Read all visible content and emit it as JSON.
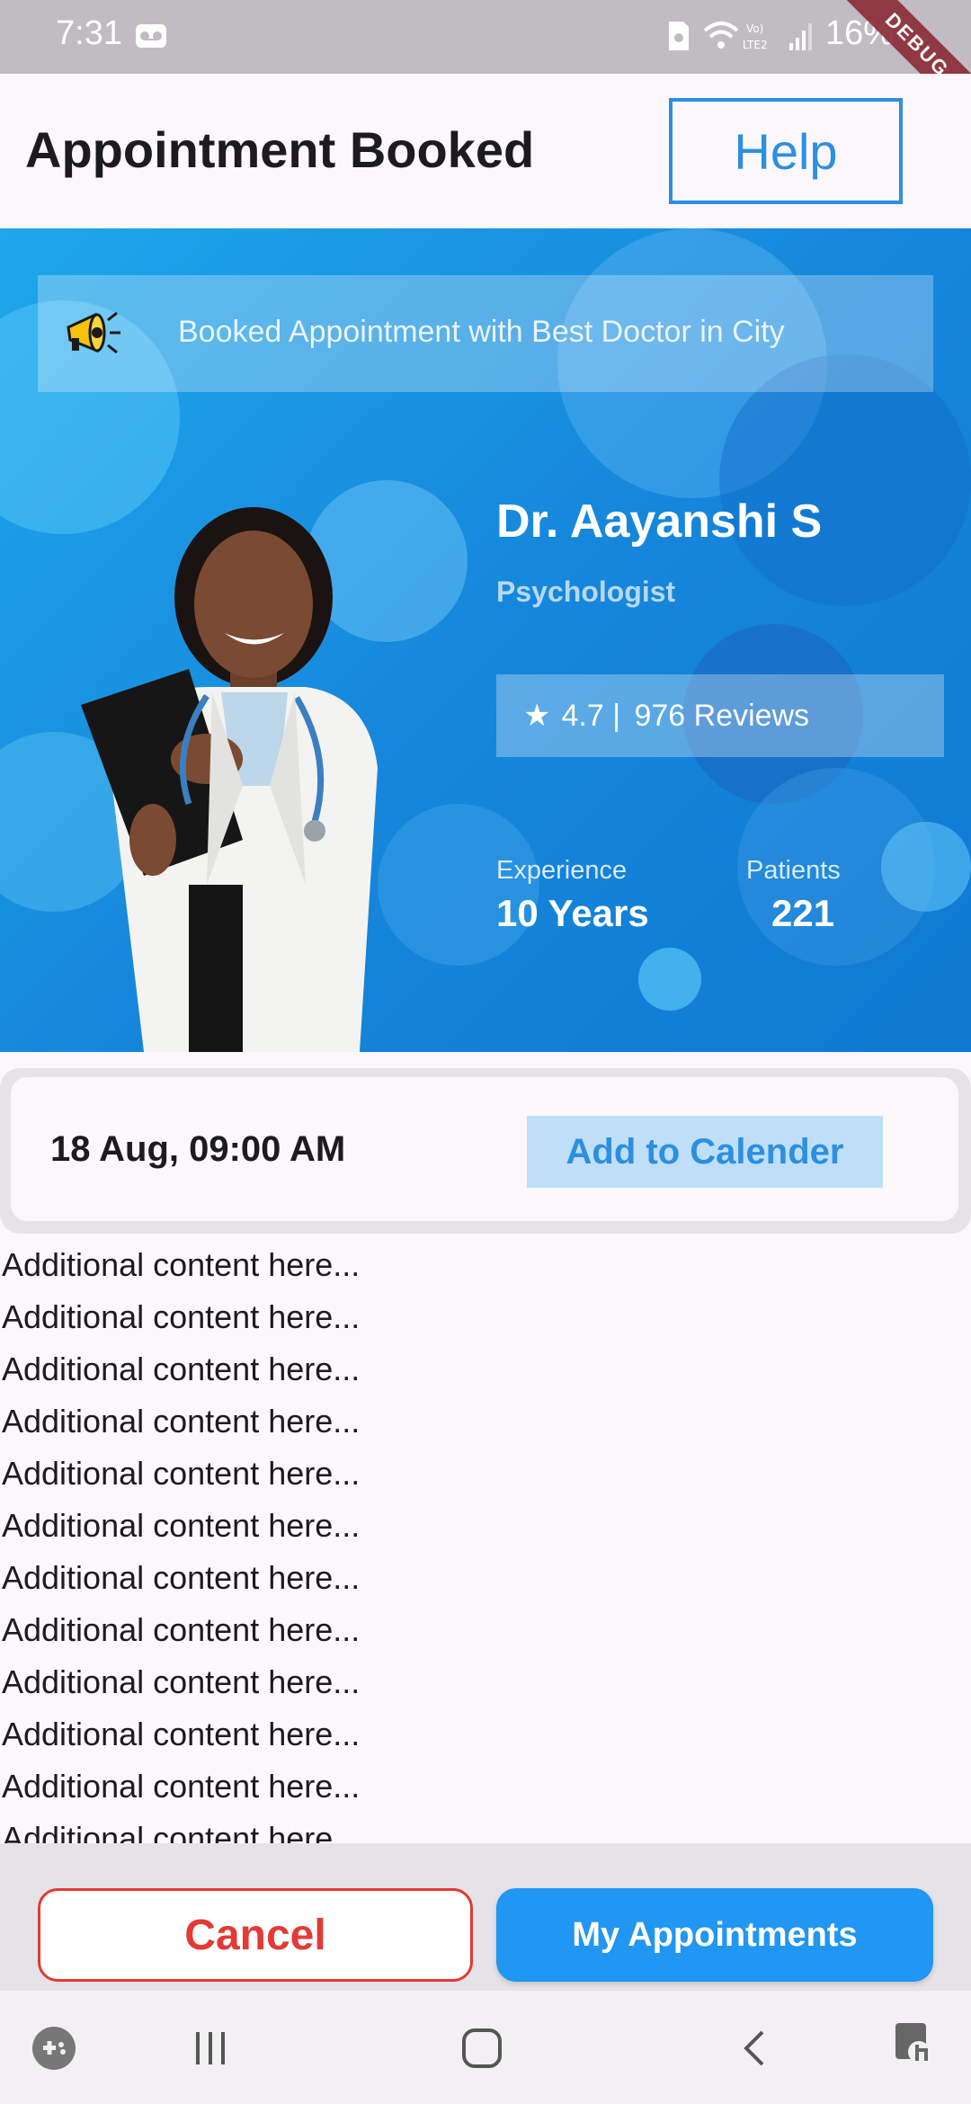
{
  "status_bar": {
    "time": "7:31",
    "battery": "16%",
    "debug_label": "DEBUG"
  },
  "header": {
    "title": "Appointment Booked",
    "help_label": "Help"
  },
  "banner": {
    "icon": "megaphone-icon",
    "text": "Booked Appointment with Best Doctor in City"
  },
  "doctor": {
    "name": "Dr. Aayanshi S",
    "specialty": "Psychologist",
    "rating_star": "★",
    "rating": "4.7 | ",
    "reviews": "976 Reviews",
    "experience_label": "Experience",
    "experience_value": "10 Years",
    "patients_label": "Patients",
    "patients_value": "221"
  },
  "appointment": {
    "datetime": "18 Aug, 09:00 AM",
    "add_calendar_label": "Add to Calender"
  },
  "content_lines": [
    "Additional content here...",
    "Additional content here...",
    "Additional content here...",
    "Additional content here...",
    "Additional content here...",
    "Additional content here...",
    "Additional content here...",
    "Additional content here...",
    "Additional content here...",
    "Additional content here...",
    "Additional content here...",
    "Additional content here..."
  ],
  "actions": {
    "cancel_label": "Cancel",
    "my_appointments_label": "My Appointments"
  },
  "colors": {
    "primary": "#2196f3",
    "danger": "#e53935",
    "hero_blue": "#1687dc"
  }
}
